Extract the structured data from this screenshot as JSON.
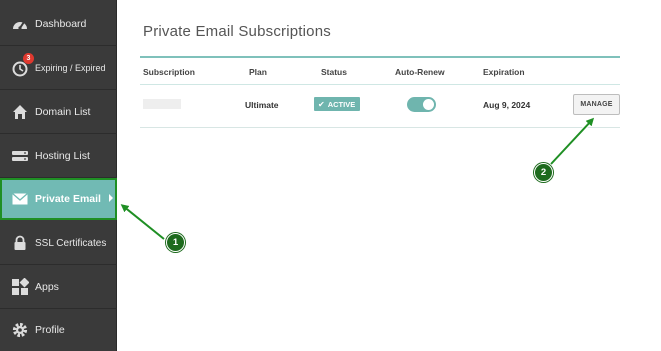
{
  "sidebar": {
    "items": [
      {
        "label": "Dashboard",
        "icon": "dashboard-gauge-icon"
      },
      {
        "label": "Expiring / Expired",
        "icon": "clock-refresh-icon",
        "badge": "3"
      },
      {
        "label": "Domain List",
        "icon": "home-icon"
      },
      {
        "label": "Hosting List",
        "icon": "server-icon"
      },
      {
        "label": "Private Email",
        "icon": "envelope-icon",
        "active": true
      },
      {
        "label": "SSL Certificates",
        "icon": "lock-icon"
      },
      {
        "label": "Apps",
        "icon": "apps-grid-icon"
      },
      {
        "label": "Profile",
        "icon": "gear-icon"
      }
    ]
  },
  "main": {
    "title": "Private Email Subscriptions",
    "columns": [
      "Subscription",
      "Plan",
      "Status",
      "Auto-Renew",
      "Expiration"
    ],
    "row": {
      "subscription": "",
      "plan": "Ultimate",
      "status": "ACTIVE",
      "auto_renew": true,
      "expiration": "Aug 9, 2024",
      "manage_label": "MANAGE"
    }
  },
  "annotations": {
    "step1": "1",
    "step2": "2"
  },
  "colors": {
    "sidebar_bg": "#3a3a3a",
    "accent": "#71bab4",
    "annotation_green": "#1e6b1e",
    "badge_red": "#e0392f"
  }
}
